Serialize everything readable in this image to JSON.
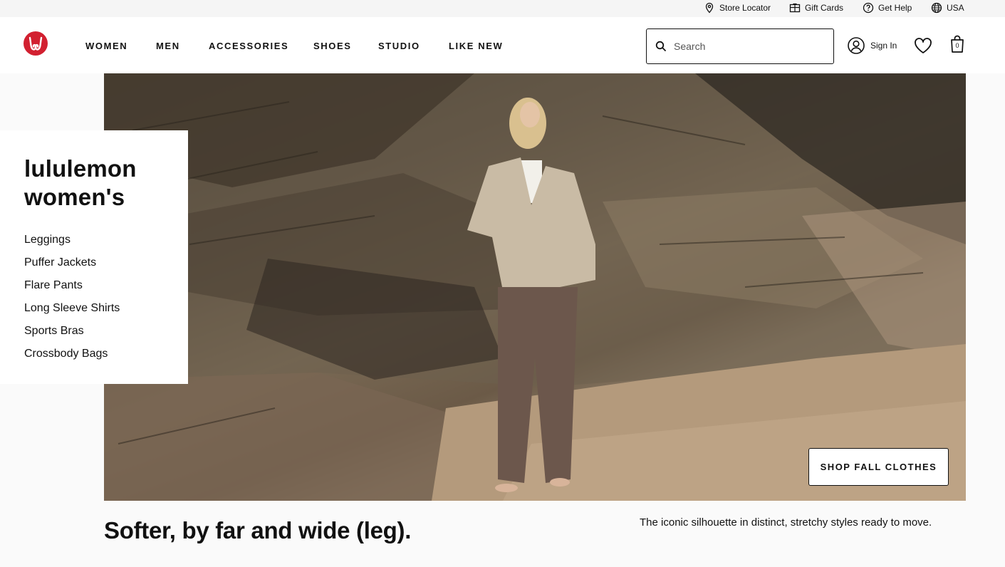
{
  "utility": {
    "items": [
      {
        "label": "Store Locator",
        "icon": "map-pin-icon"
      },
      {
        "label": "Gift Cards",
        "icon": "gift-card-icon"
      },
      {
        "label": "Get Help",
        "icon": "help-circle-icon"
      },
      {
        "label": "USA",
        "icon": "globe-icon"
      }
    ]
  },
  "header": {
    "logo": "lululemon-logo-icon",
    "nav": [
      "WOMEN",
      "MEN",
      "ACCESSORIES",
      "SHOES",
      "STUDIO",
      "LIKE NEW"
    ],
    "search_placeholder": "Search",
    "signin_label": "Sign In",
    "bag_count": "0"
  },
  "hero": {
    "title_line1": "lululemon",
    "title_line2": "women's",
    "links": [
      "Leggings",
      "Puffer Jackets",
      "Flare Pants",
      "Long Sleeve Shirts",
      "Sports Bras",
      "Crossbody Bags"
    ],
    "cta_label": "SHOP FALL CLOTHES"
  },
  "promo": {
    "headline": "Softer, by far and wide (leg).",
    "tagline": "The iconic silhouette in distinct, stretchy styles ready to move."
  },
  "colors": {
    "brand_red": "#d22030",
    "text": "#111111",
    "background": "#fafafa"
  }
}
